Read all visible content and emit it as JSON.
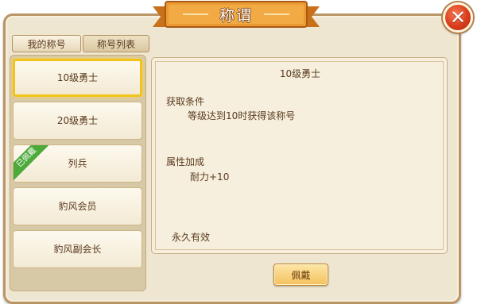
{
  "window": {
    "title": "称谓"
  },
  "tabs": [
    {
      "label": "我的称号"
    },
    {
      "label": "称号列表"
    }
  ],
  "titles_list": {
    "items": [
      {
        "label": "10级勇士",
        "state": "selected"
      },
      {
        "label": "20级勇士"
      },
      {
        "label": "列兵",
        "badge": "已佩戴"
      },
      {
        "label": "豹风会员"
      },
      {
        "label": "豹风副会长"
      }
    ]
  },
  "detail": {
    "title": "10级勇士",
    "condition_heading": "获取条件",
    "condition_text": "等级达到10时获得该称号",
    "attribute_heading": "属性加成",
    "attribute_text": "耐力+10",
    "duration": "永久有效"
  },
  "actions": {
    "wear_label": "佩戴"
  },
  "colors": {
    "panel_bg": "#efe6d1",
    "selected_border": "#f2c318",
    "badge_green": "#4caa3b",
    "close_red": "#d93d1c",
    "ribbon_orange": "#e9902c"
  }
}
